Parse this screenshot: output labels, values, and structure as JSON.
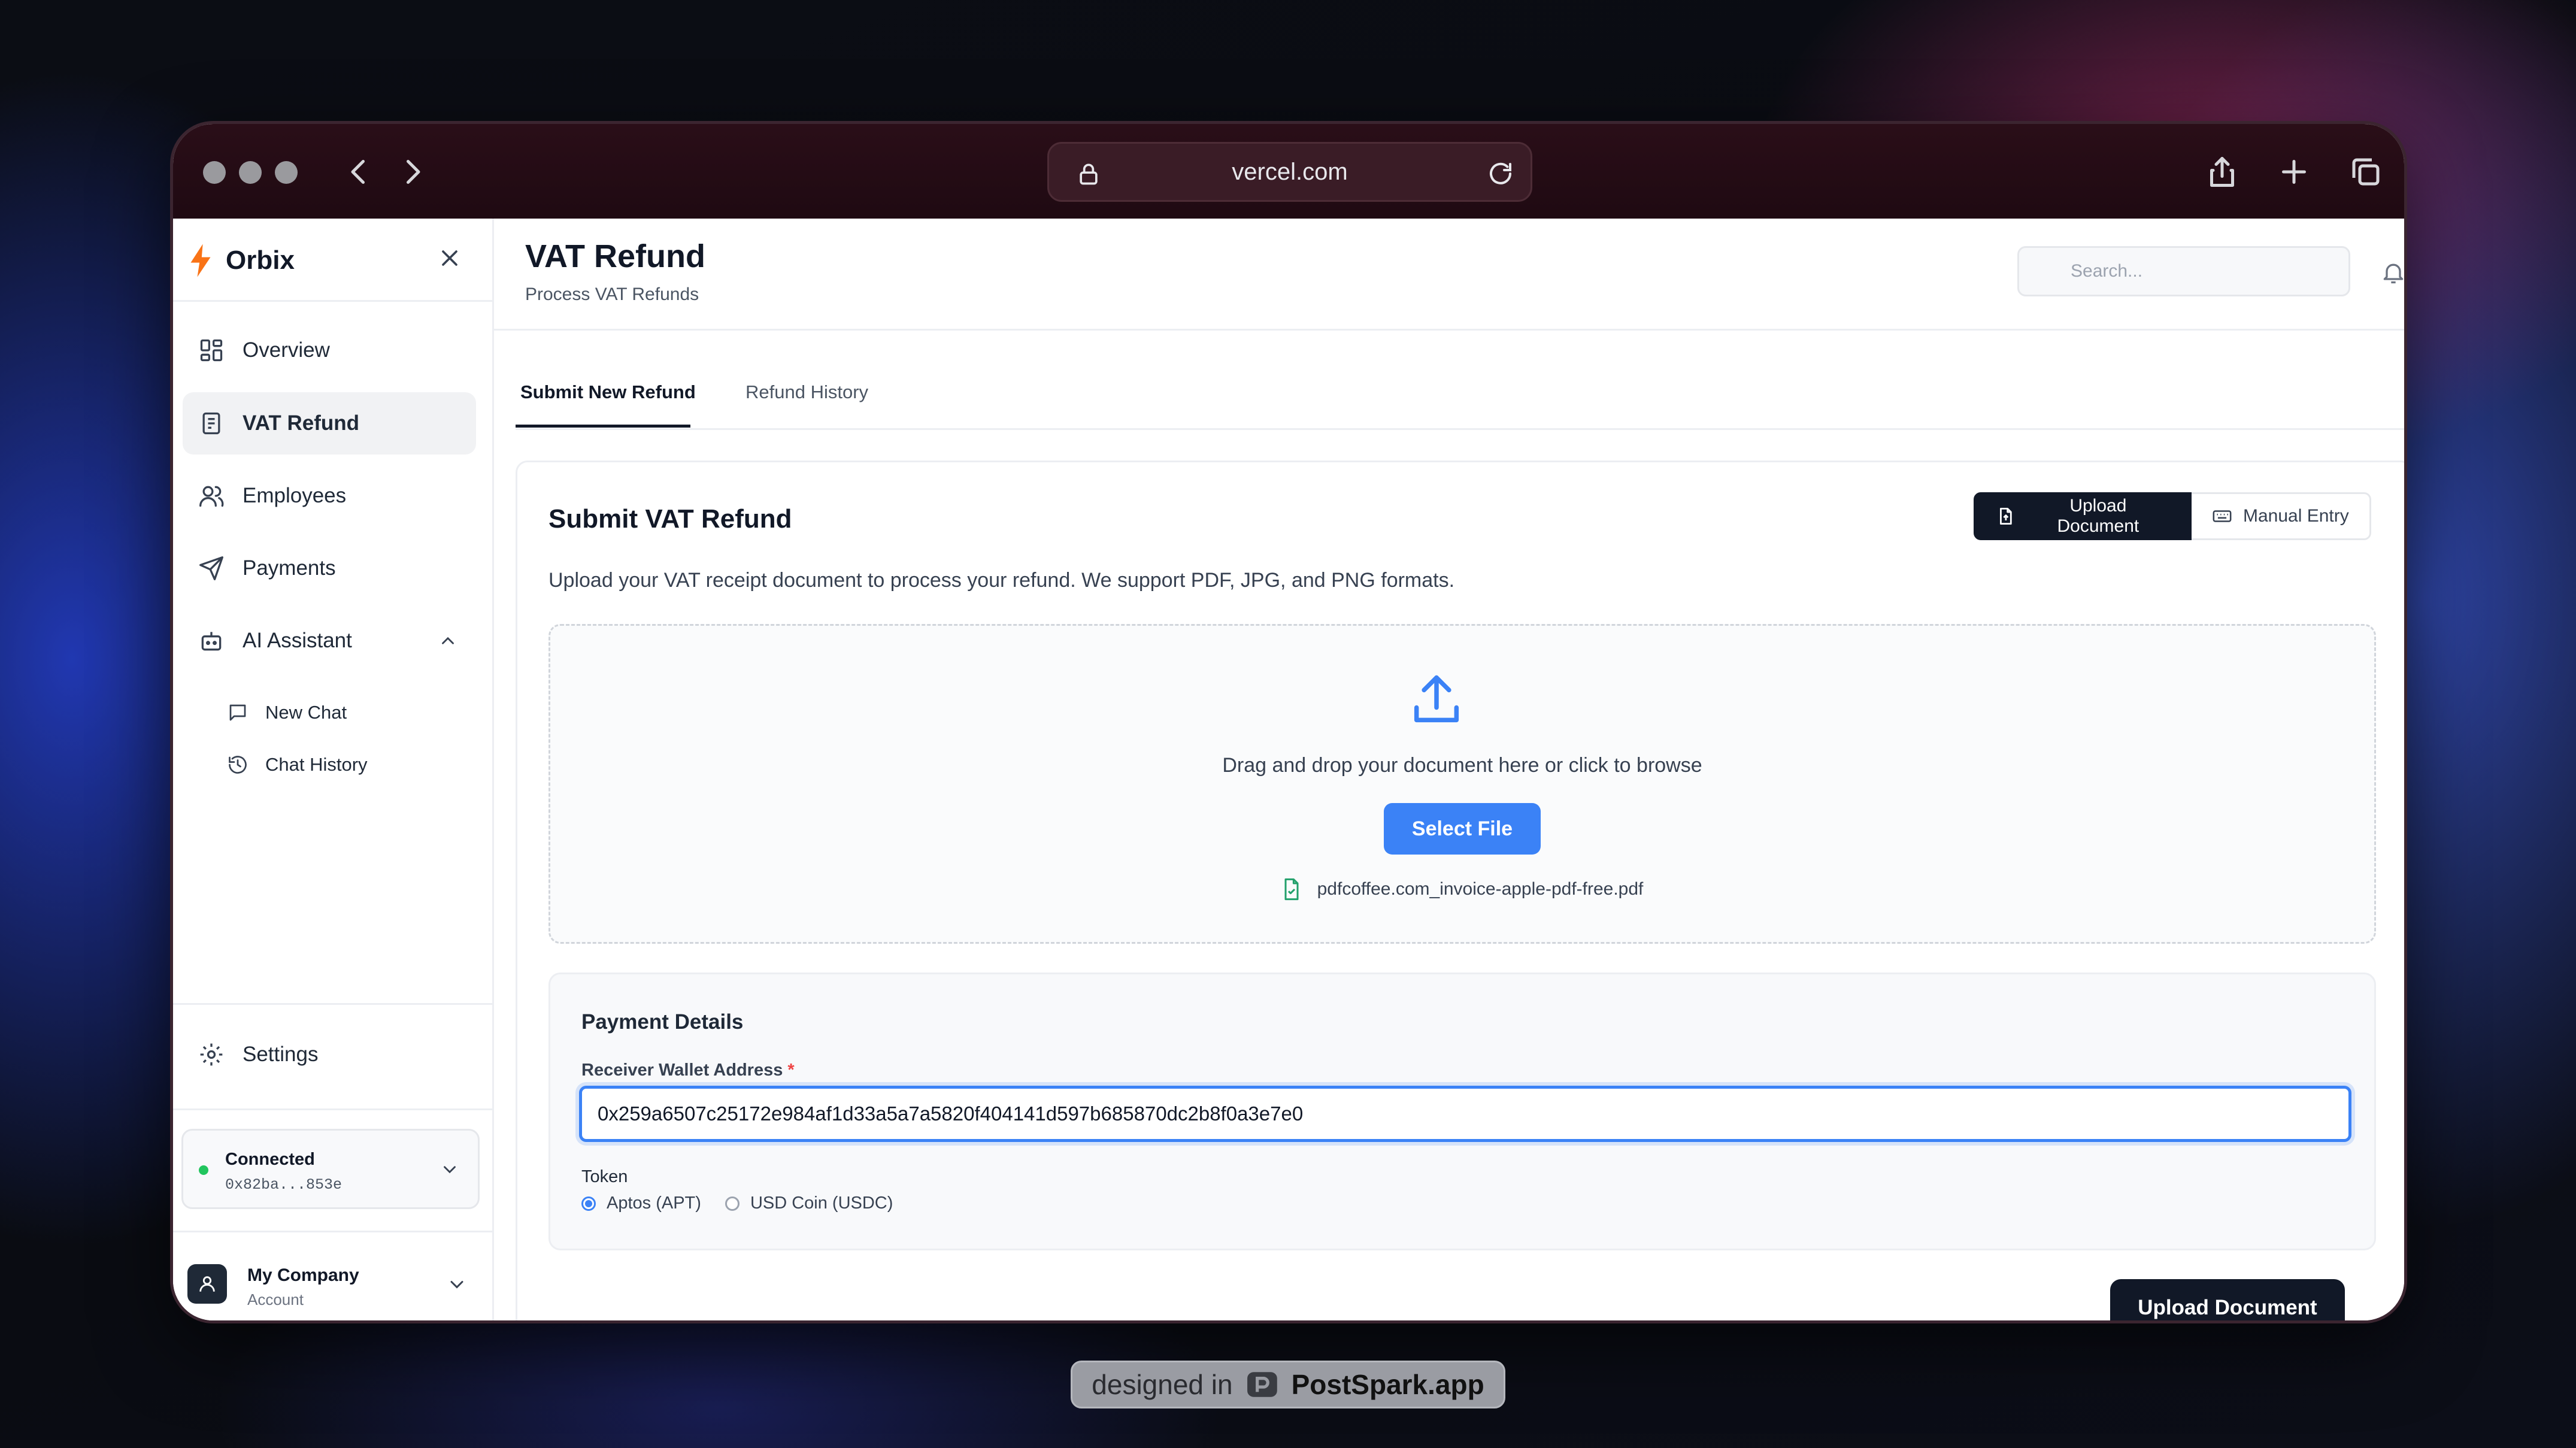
{
  "browser": {
    "url": "vercel.com"
  },
  "sidebar": {
    "brand": "Orbix",
    "items": [
      {
        "label": "Overview",
        "icon": "grid-icon"
      },
      {
        "label": "VAT Refund",
        "icon": "receipt-icon",
        "active": true
      },
      {
        "label": "Employees",
        "icon": "users-icon"
      },
      {
        "label": "Payments",
        "icon": "send-icon"
      },
      {
        "label": "AI Assistant",
        "icon": "bot-icon",
        "expanded": true
      }
    ],
    "subitems": [
      {
        "label": "New Chat",
        "icon": "chat-icon"
      },
      {
        "label": "Chat History",
        "icon": "history-icon"
      }
    ],
    "settings_label": "Settings",
    "wallet": {
      "status": "Connected",
      "address": "0x82ba...853e",
      "status_color": "#22c55e"
    },
    "account": {
      "name": "My Company",
      "role": "Account"
    }
  },
  "header": {
    "title": "VAT Refund",
    "subtitle": "Process VAT Refunds",
    "search_placeholder": "Search..."
  },
  "tabs": [
    {
      "label": "Submit New Refund",
      "active": true
    },
    {
      "label": "Refund History",
      "active": false
    }
  ],
  "form": {
    "title": "Submit VAT Refund",
    "description": "Upload your VAT receipt document to process your refund. We support PDF, JPG, and PNG formats.",
    "mode_buttons": {
      "upload": "Upload Document",
      "manual": "Manual Entry"
    },
    "dropzone": {
      "text": "Drag and drop your document here or click to browse",
      "button": "Select File",
      "file_name": "pdfcoffee.com_invoice-apple-pdf-free.pdf"
    },
    "payment": {
      "title": "Payment Details",
      "wallet_label": "Receiver Wallet Address",
      "required_mark": "*",
      "wallet_value": "0x259a6507c25172e984af1d33a5a7a5820f404141d597b685870dc2b8f0a3e7e0",
      "token_label": "Token",
      "tokens": [
        {
          "label": "Aptos (APT)",
          "selected": true
        },
        {
          "label": "USD Coin (USDC)",
          "selected": false
        }
      ]
    },
    "submit_label": "Upload Document"
  },
  "badge": {
    "prefix": "designed in",
    "brand": "PostSpark.app"
  },
  "colors": {
    "accent": "#3b82f6",
    "dark": "#111827",
    "brand": "#f97316"
  }
}
